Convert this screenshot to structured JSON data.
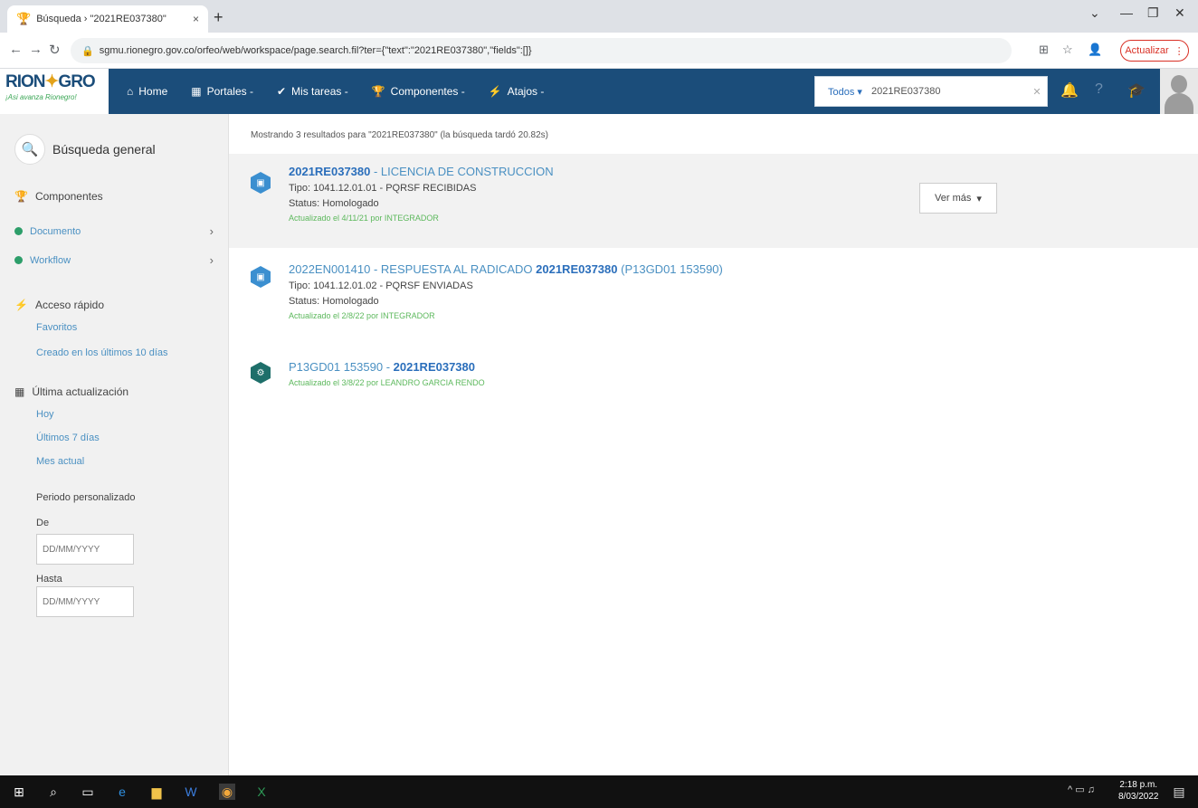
{
  "browser": {
    "tab_title": "Búsqueda › \"2021RE037380\"",
    "tab_close": "×",
    "new_tab": "+",
    "url": "sgmu.rionegro.gov.co/orfeo/web/workspace/page.search.fil?ter={\"text\":\"2021RE037380\",\"fields\":[]}",
    "update_label": "Actualizar"
  },
  "app": {
    "logo": {
      "part1": "RION",
      "part2": "GRO",
      "tagline": "¡Asi avanza Rionegro!"
    },
    "menu": [
      {
        "label": "Home",
        "icon": "home-icon"
      },
      {
        "label": "Portales -",
        "icon": "grid-icon"
      },
      {
        "label": "Mis tareas -",
        "icon": "check-icon"
      },
      {
        "label": "Componentes -",
        "icon": "trophy-icon"
      },
      {
        "label": "Atajos -",
        "icon": "bolt-icon"
      }
    ],
    "search": {
      "scope": "Todos ▾",
      "value": "2021RE037380"
    }
  },
  "sidebar": {
    "title": "Búsqueda general",
    "components_heading": "Componentes",
    "components": [
      {
        "label": "Documento"
      },
      {
        "label": "Workflow"
      }
    ],
    "quick_access_heading": "Acceso rápido",
    "quick_links": [
      "Favoritos",
      "Creado en los últimos 10 días"
    ],
    "last_update_heading": "Última actualización",
    "update_links": [
      "Hoy",
      "Últimos 7 días",
      "Mes actual"
    ],
    "custom_period_label": "Periodo personalizado",
    "from_label": "De",
    "from_placeholder": "DD/MM/YYYY",
    "to_label": "Hasta",
    "to_placeholder": "DD/MM/YYYY"
  },
  "main": {
    "summary": "Mostrando 3 resultados para \"2021RE037380\" (la búsqueda tardó 20.82s)",
    "results": [
      {
        "code": "2021RE037380",
        "title_rest": " - LICENCIA DE CONSTRUCCION",
        "tipo": "Tipo: 1041.12.01.01 - PQRSF RECIBIDAS",
        "status": "Status: Homologado",
        "updated": "Actualizado el 4/11/21 por INTEGRADOR",
        "more": "Ver más",
        "icon_color": "#3b8fd0"
      },
      {
        "title_prefix": "2022EN001410 - RESPUESTA AL RADICADO ",
        "code": "2021RE037380",
        "title_rest": " (P13GD01 153590)",
        "tipo": "Tipo: 1041.12.01.02 - PQRSF ENVIADAS",
        "status": "Status: Homologado",
        "updated": "Actualizado el 2/8/22 por INTEGRADOR",
        "icon_color": "#3b8fd0"
      },
      {
        "title_prefix": "P13GD01 153590 - ",
        "code": "2021RE037380",
        "updated": "Actualizado el 3/8/22 por LEANDRO GARCIA RENDO",
        "icon_color": "#1e6f6a"
      }
    ]
  },
  "taskbar": {
    "time": "2:18 p.m.",
    "date": "8/03/2022"
  }
}
